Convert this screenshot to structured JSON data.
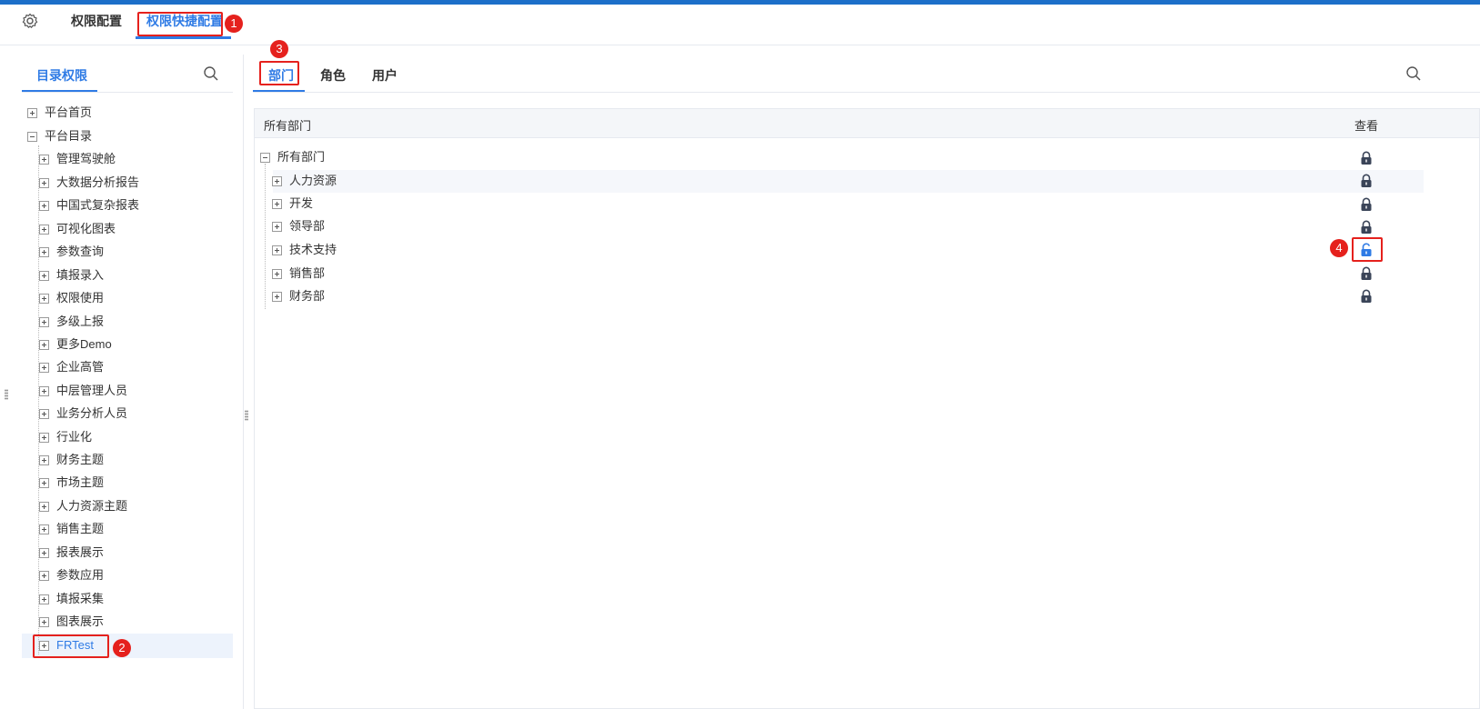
{
  "header": {
    "tabs": [
      {
        "label": "权限配置"
      },
      {
        "label": "权限快捷配置"
      }
    ]
  },
  "left_panel": {
    "tab": "目录权限",
    "tree": [
      {
        "label": "平台首页"
      },
      {
        "label": "平台目录"
      },
      {
        "label": "管理驾驶舱"
      },
      {
        "label": "大数据分析报告"
      },
      {
        "label": "中国式复杂报表"
      },
      {
        "label": "可视化图表"
      },
      {
        "label": "参数查询"
      },
      {
        "label": "填报录入"
      },
      {
        "label": "权限使用"
      },
      {
        "label": "多级上报"
      },
      {
        "label": "更多Demo"
      },
      {
        "label": "企业高管"
      },
      {
        "label": "中层管理人员"
      },
      {
        "label": "业务分析人员"
      },
      {
        "label": "行业化"
      },
      {
        "label": "财务主题"
      },
      {
        "label": "市场主题"
      },
      {
        "label": "人力资源主题"
      },
      {
        "label": "销售主题"
      },
      {
        "label": "报表展示"
      },
      {
        "label": "参数应用"
      },
      {
        "label": "填报采集"
      },
      {
        "label": "图表展示"
      },
      {
        "label": "FRTest"
      }
    ]
  },
  "right_panel": {
    "tabs": [
      {
        "label": "部门"
      },
      {
        "label": "角色"
      },
      {
        "label": "用户"
      }
    ],
    "grid": {
      "col_name": "所有部门",
      "col_view": "查看",
      "root": "所有部门",
      "rows": [
        {
          "label": "人力资源",
          "view": "locked"
        },
        {
          "label": "开发",
          "view": "locked"
        },
        {
          "label": "领导部",
          "view": "locked"
        },
        {
          "label": "技术支持",
          "view": "unlocked"
        },
        {
          "label": "销售部",
          "view": "locked"
        },
        {
          "label": "财务部",
          "view": "locked"
        }
      ],
      "root_view": "locked"
    }
  },
  "annotations": {
    "badges": [
      "1",
      "2",
      "3",
      "4"
    ]
  },
  "colors": {
    "accent": "#2f7be5",
    "callout": "#e5211d",
    "top_strip": "#1c6fc9"
  }
}
